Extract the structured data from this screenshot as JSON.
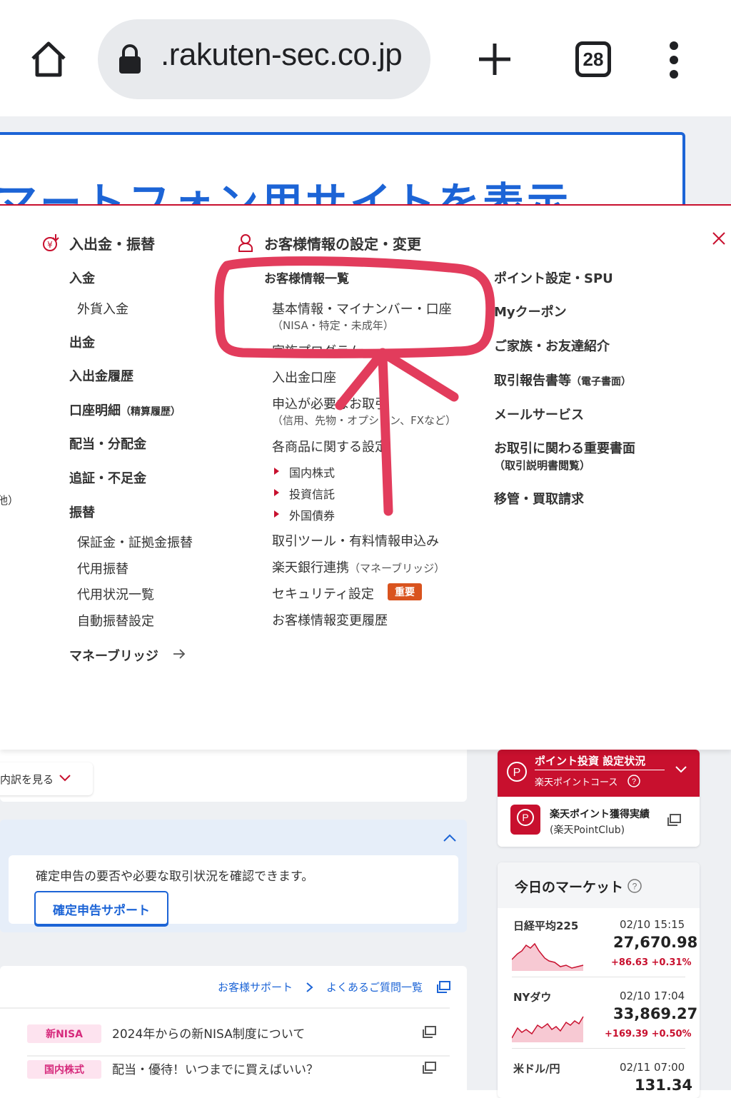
{
  "browser": {
    "url": ".rakuten-sec.co.jp",
    "tab_count": "28"
  },
  "banner": {
    "text": "マートフォン用サイトを表示"
  },
  "menu": {
    "col1": {
      "heading": "入出金・振替",
      "items": {
        "deposit": "入金",
        "fx_deposit": "外貨入金",
        "withdraw": "出金",
        "history": "入出金履歴",
        "statement": "口座明細",
        "statement_sub": "（精算履歴）",
        "dividends": "配当・分配金",
        "margin_call": "追証・不足金",
        "transfer": "振替",
        "transfer_margin": "保証金・証拠金振替",
        "transfer_collateral": "代用振替",
        "collateral_status": "代用状況一覧",
        "auto_transfer": "自動振替設定",
        "money_bridge": "マネーブリッジ"
      }
    },
    "col2": {
      "heading": "お客様情報の設定・変更",
      "items": {
        "list": "お客様情報一覧",
        "basic": "基本情報・マイナンバー・口座",
        "basic_sub": "（NISA・特定・未成年）",
        "family": "家族プログラム",
        "bank": "入出金口座",
        "apply": "申込が必要なお取引",
        "apply_sub": "（信用、先物・オプション、FXなど）",
        "products": "各商品に関する設定",
        "domestic": "国内株式",
        "funds": "投資信託",
        "bonds": "外国債券",
        "tools": "取引ツール・有料情報申込み",
        "bank_link": "楽天銀行連携",
        "bank_link_sub": "（マネーブリッジ）",
        "security": "セキュリティ設定",
        "security_badge": "重要",
        "change_history": "お客様情報変更履歴"
      }
    },
    "col3": {
      "items": {
        "point": "ポイント設定・SPU",
        "coupon": "Myクーポン",
        "family_friend": "ご家族・お友達紹介",
        "reports": "取引報告書等",
        "reports_sub": "（電子書面）",
        "mail": "メールサービス",
        "docs": "お取引に関わる重要書面",
        "docs_sub": "（取引説明書閲覧）",
        "transfer_req": "移管・買取請求"
      }
    },
    "edge_fragment": "他）"
  },
  "lower": {
    "breakdown_link": "内訳を見る",
    "tax_text": "確定申告の要否や必要な取引状況を確認できます。",
    "tax_button": "確定申告サポート",
    "support_link": "お客様サポート",
    "faq_link": "よくあるご質問一覧",
    "faq_rows": [
      {
        "tag": "新NISA",
        "text": "2024年からの新NISA制度について"
      },
      {
        "tag": "国内株式",
        "text": "配当・優待！いつまでに買えばいい？"
      }
    ]
  },
  "points": {
    "title": "ポイント投資 設定状況",
    "course": "楽天ポイントコース",
    "club_title": "楽天ポイント獲得実績",
    "club_sub": "(楽天PointClub)"
  },
  "market": {
    "title": "今日のマーケット",
    "rows": [
      {
        "name": "日経平均225",
        "time": "02/10 15:15",
        "value": "27,670.98",
        "change": "+86.63 +0.31%"
      },
      {
        "name": "NYダウ",
        "time": "02/10 17:04",
        "value": "33,869.27",
        "change": "+169.39 +0.50%"
      },
      {
        "name": "米ドル/円",
        "time": "02/11 07:00",
        "value": "131.34",
        "change": ""
      }
    ]
  },
  "colors": {
    "brand_red": "#c8102e",
    "link_blue": "#1c64d6",
    "annotation_red": "#e23c5c",
    "badge_orange": "#d9531e"
  }
}
